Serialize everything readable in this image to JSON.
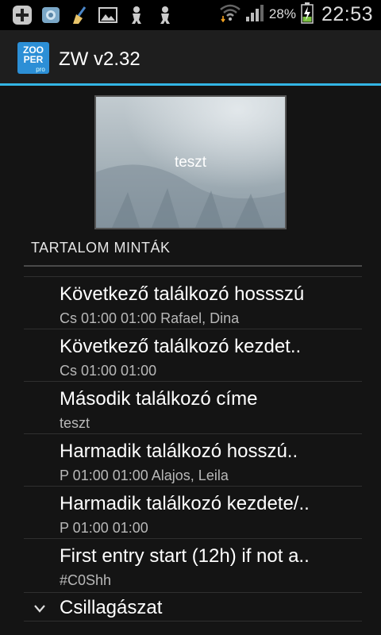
{
  "statusbar": {
    "icons": [
      "add-icon",
      "gallery-app-icon",
      "broom-icon",
      "image-icon",
      "robot-icon",
      "robot-icon"
    ],
    "battery_percent": "28%",
    "time": "22:53"
  },
  "app": {
    "logo_text": [
      "ZOO",
      "PER",
      "pro"
    ],
    "title": "ZW v2.32",
    "accent": "#33b5e5"
  },
  "preview": {
    "text": "teszt"
  },
  "section": {
    "header": "TARTALOM MINTÁK"
  },
  "list": {
    "items": [
      {
        "title": "Következő találkozó hossszú",
        "subtitle": "Cs 01:00 01:00 Rafael, Dina"
      },
      {
        "title": "Következő találkozó kezdet..",
        "subtitle": "Cs 01:00 01:00"
      },
      {
        "title": "Második találkozó címe",
        "subtitle": "teszt"
      },
      {
        "title": "Harmadik találkozó hosszú..",
        "subtitle": "P 01:00 01:00 Alajos, Leila"
      },
      {
        "title": "Harmadik találkozó kezdete/..",
        "subtitle": "P 01:00 01:00"
      },
      {
        "title": "First entry start (12h) if not a..",
        "subtitle": "#C0Shh"
      }
    ],
    "group": {
      "label": "Csillagászat"
    }
  }
}
